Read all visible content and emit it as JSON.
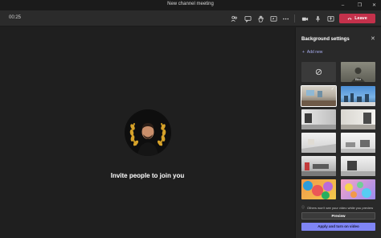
{
  "window": {
    "title": "New channel meeting"
  },
  "toolbar": {
    "timer": "00:25",
    "leave_label": "Leave"
  },
  "stage": {
    "invite_text": "Invite people to join you"
  },
  "panel": {
    "title": "Background settings",
    "add_new": "Add new",
    "blur_label": "Blur",
    "notice": "Others won't see your video while you preview",
    "preview_label": "Preview",
    "apply_label": "Apply and turn on video"
  },
  "colors": {
    "accent": "#7f85f5",
    "leave": "#c4314b",
    "panel_bg": "#292929",
    "stage_bg": "#1f1f1f"
  }
}
